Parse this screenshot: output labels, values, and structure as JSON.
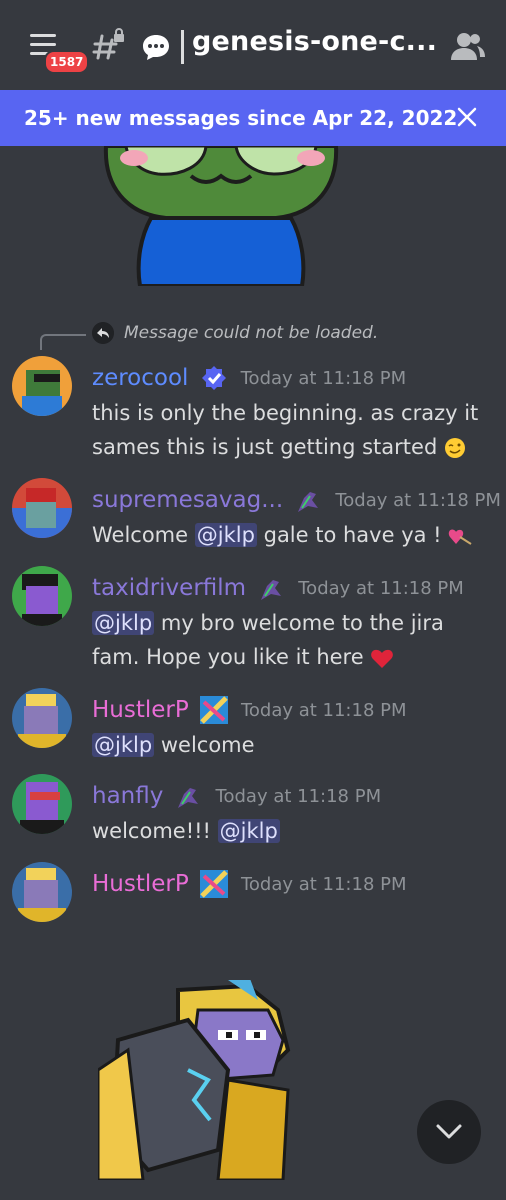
{
  "header": {
    "badge": "1587",
    "channel_title": "genesis-one-c..."
  },
  "banner": {
    "text": "25+ new messages since Apr 22, 2022"
  },
  "reply": {
    "text": "Message could not be loaded."
  },
  "colors": {
    "background": "#36393f",
    "banner": "#5865f2",
    "badge": "#ed4245",
    "mention_bg": "#414675"
  },
  "messages": [
    {
      "username": "zerocool",
      "username_color": "#5e8cff",
      "timestamp": "Today at 11:18 PM",
      "text_parts": [
        "this is only the beginning. as crazy it sames this is just getting started"
      ]
    },
    {
      "username": "supremesavag...",
      "username_color": "#8a78d9",
      "timestamp": "Today at 11:18 PM",
      "pre": "Welcome",
      "mention": "@jklp",
      "post": "gale to have ya !"
    },
    {
      "username": "taxidriverfilm",
      "username_color": "#8a78d9",
      "timestamp": "Today at 11:18 PM",
      "mention": "@jklp",
      "post": "my bro welcome to the jira fam. Hope you like it here"
    },
    {
      "username": "HustlerP",
      "username_color": "#e96dd6",
      "timestamp": "Today at 11:18 PM",
      "mention": "@jklp",
      "post": "welcome"
    },
    {
      "username": "hanfly",
      "username_color": "#8a78d9",
      "timestamp": "Today at 11:18 PM",
      "pre": "welcome!!!",
      "mention": "@jklp"
    },
    {
      "username": "HustlerP",
      "username_color": "#e96dd6",
      "timestamp": "Today at 11:18 PM"
    }
  ]
}
